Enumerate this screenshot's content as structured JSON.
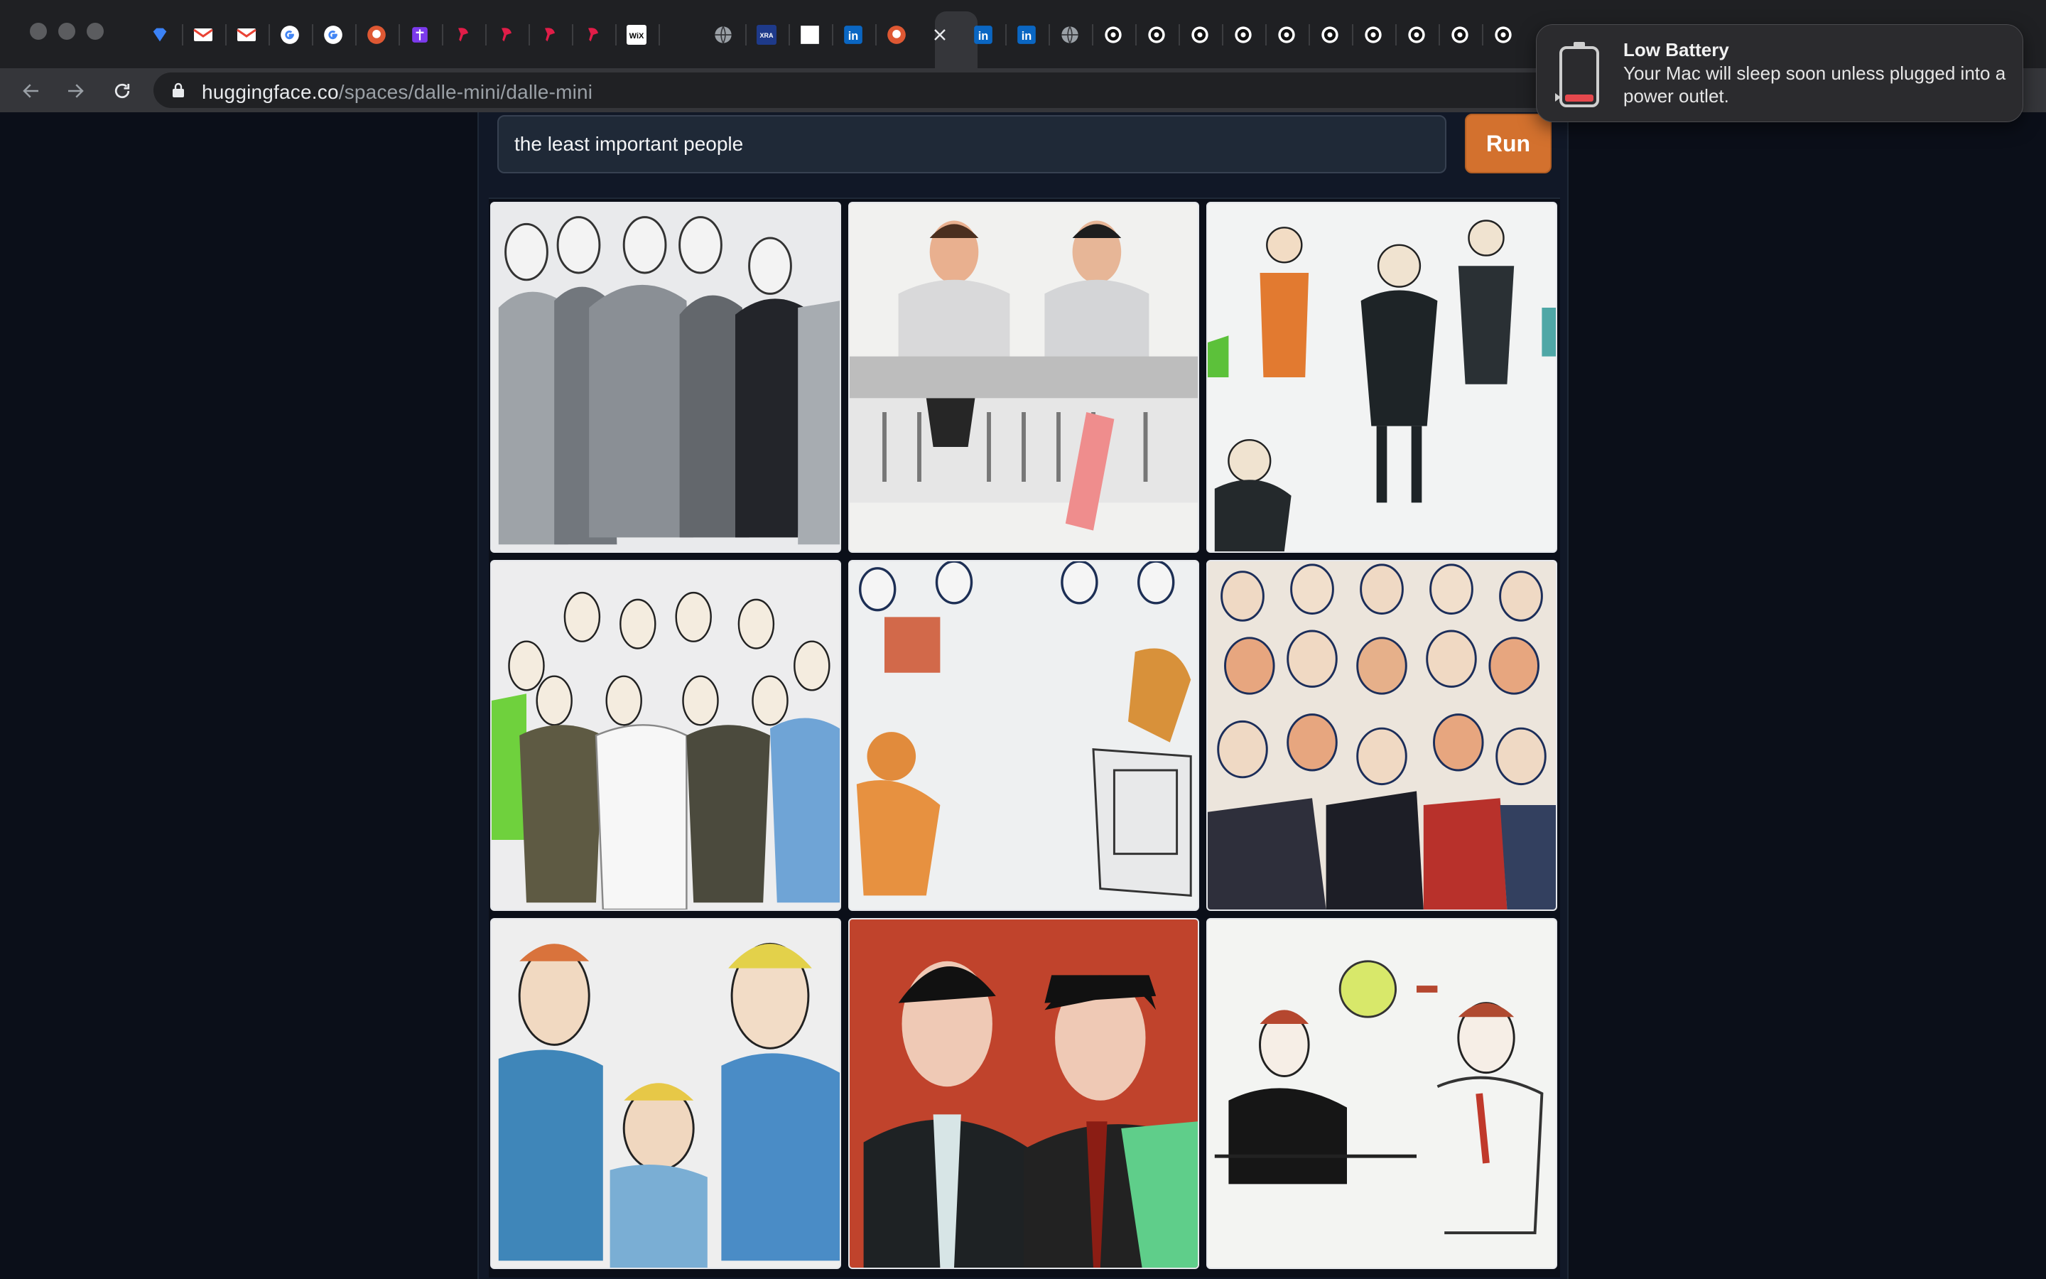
{
  "browser": {
    "url_host": "huggingface.co",
    "url_path": "/spaces/dalle-mini/dalle-mini",
    "tabs": [
      {
        "icon": "gem-icon",
        "color": "#3b82f6"
      },
      {
        "icon": "gmail-icon",
        "color": "#ea4335"
      },
      {
        "icon": "gmail-icon",
        "color": "#ea4335"
      },
      {
        "icon": "google-icon",
        "color": "#4285f4"
      },
      {
        "icon": "google-icon",
        "color": "#4285f4"
      },
      {
        "icon": "duckduckgo-icon",
        "color": "#de5833"
      },
      {
        "icon": "purple-app-icon",
        "color": "#7c3aed"
      },
      {
        "icon": "red-pin-icon",
        "color": "#e11d48"
      },
      {
        "icon": "red-pin-icon",
        "color": "#e11d48"
      },
      {
        "icon": "red-pin-icon",
        "color": "#e11d48"
      },
      {
        "icon": "red-pin-icon",
        "color": "#e11d48"
      },
      {
        "icon": "wix-icon",
        "color": "#ffffff"
      },
      {
        "icon": "globe-icon",
        "color": "#9aa0a6"
      },
      {
        "icon": "xra-icon",
        "color": "#1e3a8a"
      },
      {
        "icon": "blank-page-icon",
        "color": "#ffffff"
      },
      {
        "icon": "linkedin-icon",
        "color": "#0a66c2"
      },
      {
        "icon": "duckduckgo-icon",
        "color": "#de5833"
      },
      {
        "icon": "close-icon",
        "color": "#e8eaed"
      },
      {
        "icon": "linkedin-icon",
        "color": "#0a66c2"
      },
      {
        "icon": "linkedin-icon",
        "color": "#0a66c2"
      },
      {
        "icon": "globe-icon",
        "color": "#9aa0a6"
      },
      {
        "icon": "gear-icon",
        "color": "#e8eaed"
      },
      {
        "icon": "gear-icon",
        "color": "#e8eaed"
      },
      {
        "icon": "gear-icon",
        "color": "#e8eaed"
      },
      {
        "icon": "gear-icon",
        "color": "#e8eaed"
      },
      {
        "icon": "gear-icon",
        "color": "#e8eaed"
      },
      {
        "icon": "gear-icon",
        "color": "#e8eaed"
      },
      {
        "icon": "gear-icon",
        "color": "#e8eaed"
      },
      {
        "icon": "gear-icon",
        "color": "#e8eaed"
      },
      {
        "icon": "gear-icon",
        "color": "#e8eaed"
      },
      {
        "icon": "gear-icon",
        "color": "#e8eaed"
      }
    ],
    "tab_labels": {
      "wix": "WiX",
      "xra": "XRA",
      "linkedin": "in"
    }
  },
  "app": {
    "prompt_value": "the least important people",
    "run_label": "Run",
    "accent_color": "#d3712e",
    "gallery": [
      {
        "name": "generated-image-1",
        "palette": "grey-crowd"
      },
      {
        "name": "generated-image-2",
        "palette": "panel-table"
      },
      {
        "name": "generated-image-3",
        "palette": "scattered-suits"
      },
      {
        "name": "generated-image-4",
        "palette": "group-portrait"
      },
      {
        "name": "generated-image-5",
        "palette": "chairs-room"
      },
      {
        "name": "generated-image-6",
        "palette": "dense-crowd"
      },
      {
        "name": "generated-image-7",
        "palette": "blue-trio"
      },
      {
        "name": "generated-image-8",
        "palette": "red-duo"
      },
      {
        "name": "generated-image-9",
        "palette": "sketch-men"
      }
    ]
  },
  "notification": {
    "title": "Low Battery",
    "body": "Your Mac will sleep soon unless plugged into a power outlet.",
    "icon": "battery-low-icon",
    "battery_color": "#e5484d"
  }
}
